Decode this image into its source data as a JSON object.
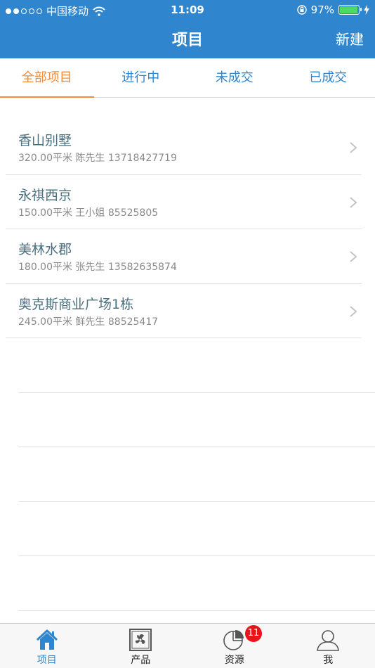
{
  "status_bar": {
    "carrier": "中国移动",
    "time": "11:09",
    "battery_percent": "97%",
    "battery_level": 0.97
  },
  "nav": {
    "title": "项目",
    "new_label": "新建"
  },
  "tabs": [
    {
      "label": "全部项目",
      "active": true
    },
    {
      "label": "进行中",
      "active": false
    },
    {
      "label": "未成交",
      "active": false
    },
    {
      "label": "已成交",
      "active": false
    }
  ],
  "projects": [
    {
      "name": "香山别墅",
      "detail": "320.00平米 陈先生 13718427719"
    },
    {
      "name": "永祺西京",
      "detail": "150.00平米 王小姐 85525805"
    },
    {
      "name": "美林水郡",
      "detail": "180.00平米 张先生 13582635874"
    },
    {
      "name": "奥克斯商业广场1栋",
      "detail": "245.00平米 鲜先生 88525417"
    }
  ],
  "tabbar": {
    "items": [
      {
        "label": "项目",
        "icon": "home-icon",
        "active": true
      },
      {
        "label": "产品",
        "icon": "fan-icon",
        "active": false
      },
      {
        "label": "资源",
        "icon": "pie-chart-icon",
        "active": false
      },
      {
        "label": "我",
        "icon": "user-icon",
        "active": false
      }
    ],
    "resources_badge": "11"
  },
  "colors": {
    "brand_blue": "#2f86ce",
    "active_orange": "#f08c3a",
    "badge_red": "#e8141a"
  }
}
